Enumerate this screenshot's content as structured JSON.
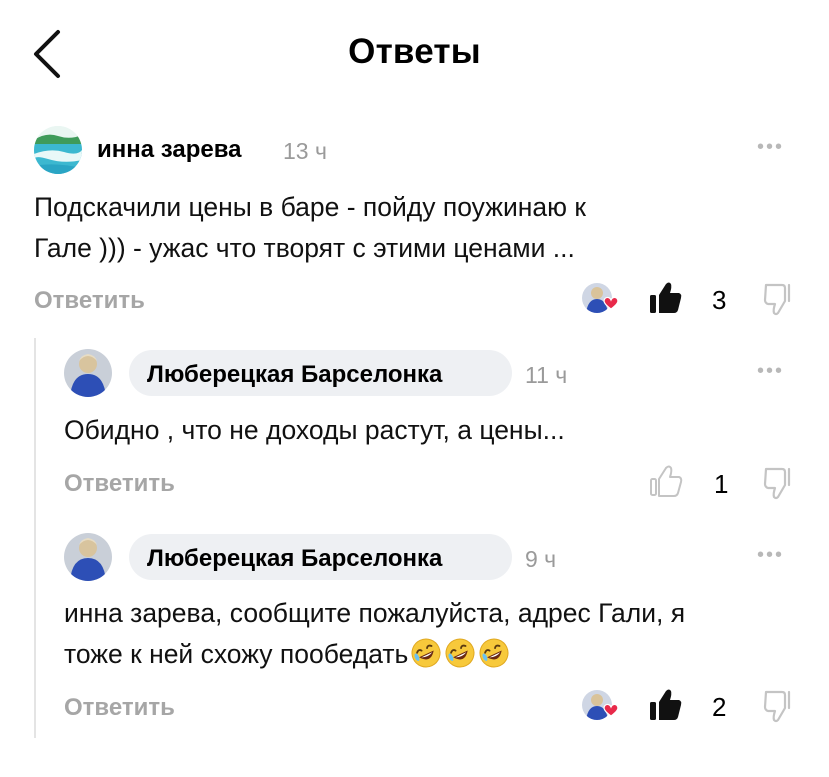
{
  "header": {
    "title": "Ответы"
  },
  "comments": [
    {
      "author": "инна зарева",
      "time": "13 ч",
      "text_lines": [
        "Подскачили цены в баре  - пойду  поужинаю к",
        "Гале ))) - ужас что творят  с этими ценами ..."
      ],
      "reply_label": "Ответить",
      "likes": "3",
      "liked": true
    },
    {
      "author": "Люберецкая Барселонка",
      "time": "11 ч",
      "text_lines": [
        "Обидно , что не доходы растут, а цены..."
      ],
      "reply_label": "Ответить",
      "likes": "1",
      "liked": false
    },
    {
      "author": "Люберецкая Барселонка",
      "time": "9 ч",
      "text_lines": [
        "инна зарева, сообщите пожалуйста, адрес Гали, я",
        "тоже к ней схожу пообедать"
      ],
      "emojis": [
        "rofl-emoji",
        "rofl-emoji",
        "rofl-emoji"
      ],
      "reply_label": "Ответить",
      "likes": "2",
      "liked": true
    }
  ],
  "icons": {
    "back": "chevron-left-icon",
    "more": "more-dots-icon",
    "like": "thumbs-up-icon",
    "dislike": "thumbs-down-icon",
    "heart": "heart-icon"
  },
  "colors": {
    "muted": "#a6a6a6",
    "heart": "#e8294a",
    "pill": "#eef0f3",
    "avatar_blue": "#2d4fb6"
  }
}
